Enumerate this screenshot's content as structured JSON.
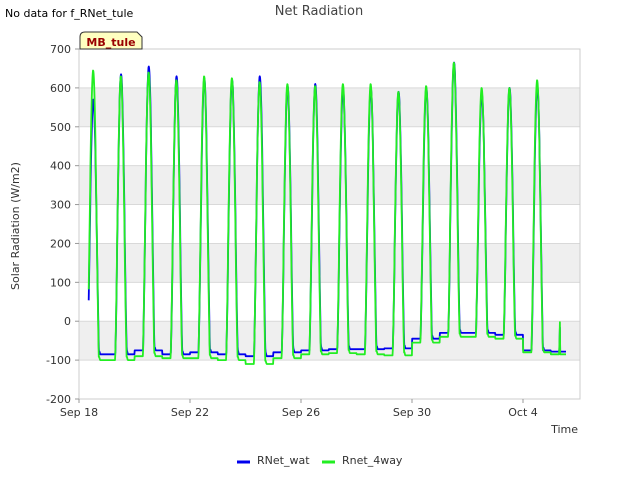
{
  "note": "No data for f_RNet_tule",
  "site_label": "MB_tule",
  "colors": {
    "RNet_wat": "#0000ee",
    "Rnet_4way": "#22ee22",
    "band": "#efefef",
    "grid": "#d9d9d9"
  },
  "chart_data": {
    "type": "line",
    "title": "Net Radiation",
    "xlabel": "Time",
    "ylabel": "Solar Radiation (W/m2)",
    "ylim": [
      -200,
      700
    ],
    "yticks": [
      -200,
      -100,
      0,
      100,
      200,
      300,
      400,
      500,
      600,
      700
    ],
    "x_range_days": [
      "2023-09-18",
      "2023-10-06"
    ],
    "xticks": [
      {
        "label": "Sep 18",
        "day": 0
      },
      {
        "label": "Sep 22",
        "day": 4
      },
      {
        "label": "Sep 26",
        "day": 8
      },
      {
        "label": "Sep 30",
        "day": 12
      },
      {
        "label": "Oct 4",
        "day": 16
      }
    ],
    "grid": true,
    "legend": "bottom-center",
    "series": [
      {
        "name": "RNet_wat",
        "daily_peaks": [
          570,
          635,
          655,
          630,
          625,
          620,
          630,
          605,
          610,
          595,
          600,
          590,
          600,
          665,
          585,
          600,
          605
        ],
        "night_levels": [
          -85,
          -85,
          -75,
          -85,
          -80,
          -85,
          -90,
          -80,
          -75,
          -72,
          -72,
          -70,
          -45,
          -30,
          -30,
          -35,
          -75,
          -78
        ]
      },
      {
        "name": "Rnet_4way",
        "daily_peaks": [
          645,
          630,
          640,
          620,
          630,
          625,
          615,
          610,
          605,
          610,
          610,
          590,
          605,
          665,
          600,
          600,
          620
        ],
        "night_levels": [
          -100,
          -100,
          -90,
          -95,
          -95,
          -100,
          -110,
          -95,
          -85,
          -82,
          -85,
          -88,
          -55,
          -40,
          -40,
          -45,
          -80,
          -85
        ]
      }
    ]
  }
}
